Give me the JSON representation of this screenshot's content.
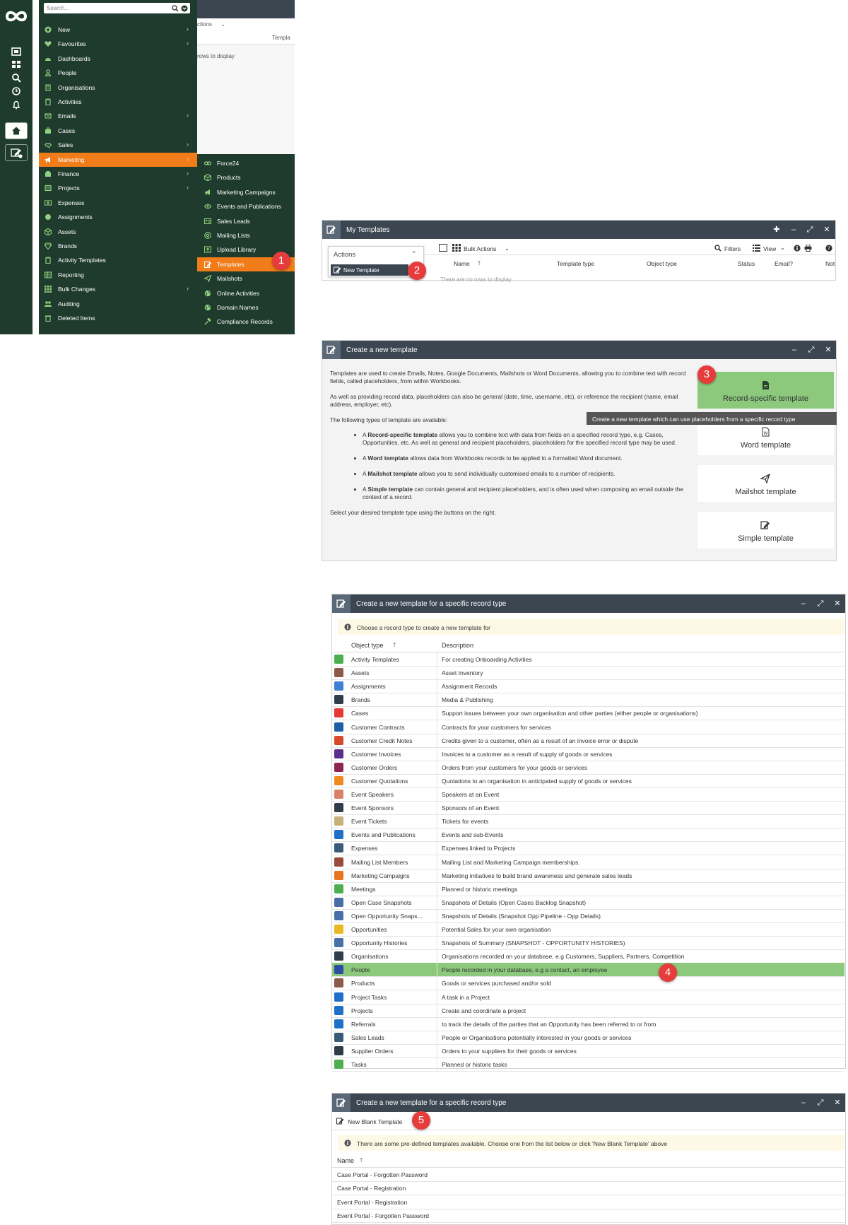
{
  "menu": {
    "search_placeholder": "Search...",
    "items": [
      {
        "label": "New",
        "chevron": true,
        "icon": "plus-circle-icon"
      },
      {
        "label": "Favourites",
        "chevron": true,
        "icon": "heart-icon"
      },
      {
        "label": "Dashboards",
        "chevron": false,
        "icon": "dashboard-icon"
      },
      {
        "label": "People",
        "chevron": false,
        "icon": "person-icon"
      },
      {
        "label": "Organisations",
        "chevron": false,
        "icon": "building-icon"
      },
      {
        "label": "Activities",
        "chevron": false,
        "icon": "clipboard-icon"
      },
      {
        "label": "Emails",
        "chevron": true,
        "icon": "envelope-icon"
      },
      {
        "label": "Cases",
        "chevron": false,
        "icon": "briefcase-icon"
      },
      {
        "label": "Sales",
        "chevron": true,
        "icon": "handshake-icon"
      },
      {
        "label": "Marketing",
        "chevron": true,
        "icon": "megaphone-icon",
        "active": true
      },
      {
        "label": "Finance",
        "chevron": true,
        "icon": "finance-icon"
      },
      {
        "label": "Projects",
        "chevron": true,
        "icon": "projects-icon"
      },
      {
        "label": "Expenses",
        "chevron": false,
        "icon": "money-icon"
      },
      {
        "label": "Assignments",
        "chevron": false,
        "icon": "circle-icon"
      },
      {
        "label": "Assets",
        "chevron": false,
        "icon": "cube-icon"
      },
      {
        "label": "Brands",
        "chevron": false,
        "icon": "gem-icon"
      },
      {
        "label": "Activity Templates",
        "chevron": false,
        "icon": "clipboard-icon"
      },
      {
        "label": "Reporting",
        "chevron": false,
        "icon": "table-icon"
      },
      {
        "label": "Bulk Changes",
        "chevron": true,
        "icon": "grid-icon"
      },
      {
        "label": "Auditing",
        "chevron": false,
        "icon": "people-icon"
      },
      {
        "label": "Deleted Items",
        "chevron": false,
        "icon": "trash-icon"
      }
    ],
    "submenu": [
      {
        "label": "Force24",
        "icon": "link-icon"
      },
      {
        "label": "Products",
        "icon": "cube-icon"
      },
      {
        "label": "Marketing Campaigns",
        "icon": "megaphone-icon"
      },
      {
        "label": "Events and Publications",
        "icon": "eye-icon"
      },
      {
        "label": "Sales Leads",
        "icon": "id-card-icon"
      },
      {
        "label": "Mailing Lists",
        "icon": "at-icon"
      },
      {
        "label": "Upload Library",
        "icon": "upload-icon"
      },
      {
        "label": "Templates",
        "icon": "edit-icon",
        "active": true
      },
      {
        "label": "Mailshots",
        "icon": "send-icon"
      },
      {
        "label": "Online Activities",
        "icon": "globe-icon"
      },
      {
        "label": "Domain Names",
        "icon": "globe-icon"
      },
      {
        "label": "Compliance Records",
        "icon": "gavel-icon"
      }
    ],
    "bg_actions": "ctions",
    "bg_template_col": "Templa",
    "bg_no_rows": "rows to display"
  },
  "my_templates": {
    "title": "My Templates",
    "actions_label": "Actions",
    "new_template": "New Template",
    "bulk_actions": "Bulk Actions",
    "filters": "Filters",
    "view": "View",
    "columns": [
      "Name",
      "Template type",
      "Object type",
      "Status",
      "Email?",
      "Not"
    ],
    "no_rows": "There are no rows to display"
  },
  "create_template": {
    "title": "Create a new template",
    "p1": "Templates are used to create Emails, Notes, Google Documents, Mailshots or Word Documents, allowing you to combine text with record fields, called placeholders, from within Workbooks.",
    "p2": "As well as providing record data, placeholders can also be general (date, time, username, etc), or reference the recipient (name, email address, employer, etc).",
    "p3": "The following types of template are available:",
    "bullets": [
      {
        "bold": "Record-specific template",
        "rest": " allows you to combine text with data from fields on a specified record type, e.g. Cases, Opportunities, etc. As well as general and recipient placeholders, placeholders for the specified record type may be used."
      },
      {
        "bold": "Word template",
        "rest": " allows data from Workbooks records to be applied to a formatted Word document."
      },
      {
        "bold": "Mailshot template",
        "rest": " allows you to send individually customised emails to a number of recipients."
      },
      {
        "bold": "Simple template",
        "rest": " can contain general and recipient placeholders, and is often used when composing an email outside the context of a record."
      }
    ],
    "article": "A",
    "p4": "Select your desired template type using the buttons on the right.",
    "buttons": [
      "Record-specific template",
      "Word template",
      "Mailshot template",
      "Simple template"
    ],
    "tooltip": "Create a new template which can use placeholders from a specific record type"
  },
  "record_type": {
    "title": "Create a new template for a specific record type",
    "info": "Choose a record type to create a new template for",
    "col_object": "Object type",
    "col_desc": "Description",
    "rows": [
      {
        "name": "Activity Templates",
        "desc": "For creating Onboarding Activities",
        "color": "#4caf50"
      },
      {
        "name": "Assets",
        "desc": "Asset Inventory",
        "color": "#8d5a4a"
      },
      {
        "name": "Assignments",
        "desc": "Assignment Records",
        "color": "#3f7fd6"
      },
      {
        "name": "Brands",
        "desc": "Media & Publishing",
        "color": "#2f3d4a"
      },
      {
        "name": "Cases",
        "desc": "Support issues between your own organisation and other parties (either people or organisations)",
        "color": "#e53935"
      },
      {
        "name": "Customer Contracts",
        "desc": "Contracts for your customers for services",
        "color": "#1e5fa8"
      },
      {
        "name": "Customer Credit Notes",
        "desc": "Credits given to a customer, often as a result of an invoice error or dispute",
        "color": "#d64a2a"
      },
      {
        "name": "Customer Invoices",
        "desc": "Invoices to a customer as a result of supply of goods or services",
        "color": "#5b2d8c"
      },
      {
        "name": "Customer Orders",
        "desc": "Orders from your customers for your goods or services",
        "color": "#8e2450"
      },
      {
        "name": "Customer Quotations",
        "desc": "Quotations to an organisation in anticipated supply of goods or services",
        "color": "#f08a1e"
      },
      {
        "name": "Event Speakers",
        "desc": "Speakers at an Event",
        "color": "#d9826a"
      },
      {
        "name": "Event Sponsors",
        "desc": "Sponsors of an Event",
        "color": "#2f3d4a"
      },
      {
        "name": "Event Tickets",
        "desc": "Tickets for events",
        "color": "#c8b07a"
      },
      {
        "name": "Events and Publications",
        "desc": "Events and sub-Events",
        "color": "#1e6fc8"
      },
      {
        "name": "Expenses",
        "desc": "Expenses linked to Projects",
        "color": "#3a5a7a"
      },
      {
        "name": "Mailing List Members",
        "desc": "Mailing List and Marketing Campaign memberships.",
        "color": "#9a4a3a"
      },
      {
        "name": "Marketing Campaigns",
        "desc": "Marketing initiatives to build brand awareness and generate sales leads",
        "color": "#e9761e"
      },
      {
        "name": "Meetings",
        "desc": "Planned or historic meetings",
        "color": "#4caf50"
      },
      {
        "name": "Open Case Snapshots",
        "desc": "Snapshots of Details (Open Cases Backlog Snapshot)",
        "color": "#4a6fa8"
      },
      {
        "name": "Open Opportunity Snaps...",
        "desc": "Snapshots of Details (Snapshot Opp Pipeline - Opp Details)",
        "color": "#4a6fa8"
      },
      {
        "name": "Opportunities",
        "desc": "Potential Sales for your own organisation",
        "color": "#e8b923"
      },
      {
        "name": "Opportunity Histories",
        "desc": "Snapshots of Summary (SNAPSHOT - OPPORTUNITY HISTORIES)",
        "color": "#4a6fa8"
      },
      {
        "name": "Organisations",
        "desc": "Organisations recorded on your database, e.g Customers, Suppliers, Partners, Competition",
        "color": "#2f3d4a"
      },
      {
        "name": "People",
        "desc": "People recorded in your database, e.g a contact, an employee",
        "color": "#2e4fa0",
        "highlight": true
      },
      {
        "name": "Products",
        "desc": "Goods or services purchased and/or sold",
        "color": "#8d5a4a"
      },
      {
        "name": "Project Tasks",
        "desc": "A task in a Project",
        "color": "#1e6fc8"
      },
      {
        "name": "Projects",
        "desc": "Create and coordinate a project",
        "color": "#1e6fc8"
      },
      {
        "name": "Referrals",
        "desc": "to track the details of the parties that an Opportunity has been referred to or from",
        "color": "#1e6fc8"
      },
      {
        "name": "Sales Leads",
        "desc": "People or Organisations potentially interested in your goods or services",
        "color": "#3a5a7a"
      },
      {
        "name": "Supplier Orders",
        "desc": "Orders to your suppliers for their goods or services",
        "color": "#2f3d4a"
      },
      {
        "name": "Tasks",
        "desc": "Planned or historic tasks",
        "color": "#4caf50"
      }
    ]
  },
  "predefined": {
    "title": "Create a new template for a specific record type",
    "new_blank": "New Blank Template",
    "info": "There are some pre-defined templates available. Choose one from the list below or click 'New Blank Template' above",
    "col_name": "Name",
    "rows": [
      "Case Portal - Forgotten Password",
      "Case Portal - Registration",
      "Event Portal - Registration",
      "Event Portal - Forgotten Password"
    ]
  },
  "steps": [
    "1",
    "2",
    "3",
    "4",
    "5"
  ],
  "colors": {
    "nav_bg": "#1e3b2d",
    "accent": "#f07d1a",
    "titlebar": "#3b4651",
    "highlight": "#8cc97d",
    "badge": "#e63c3c"
  }
}
